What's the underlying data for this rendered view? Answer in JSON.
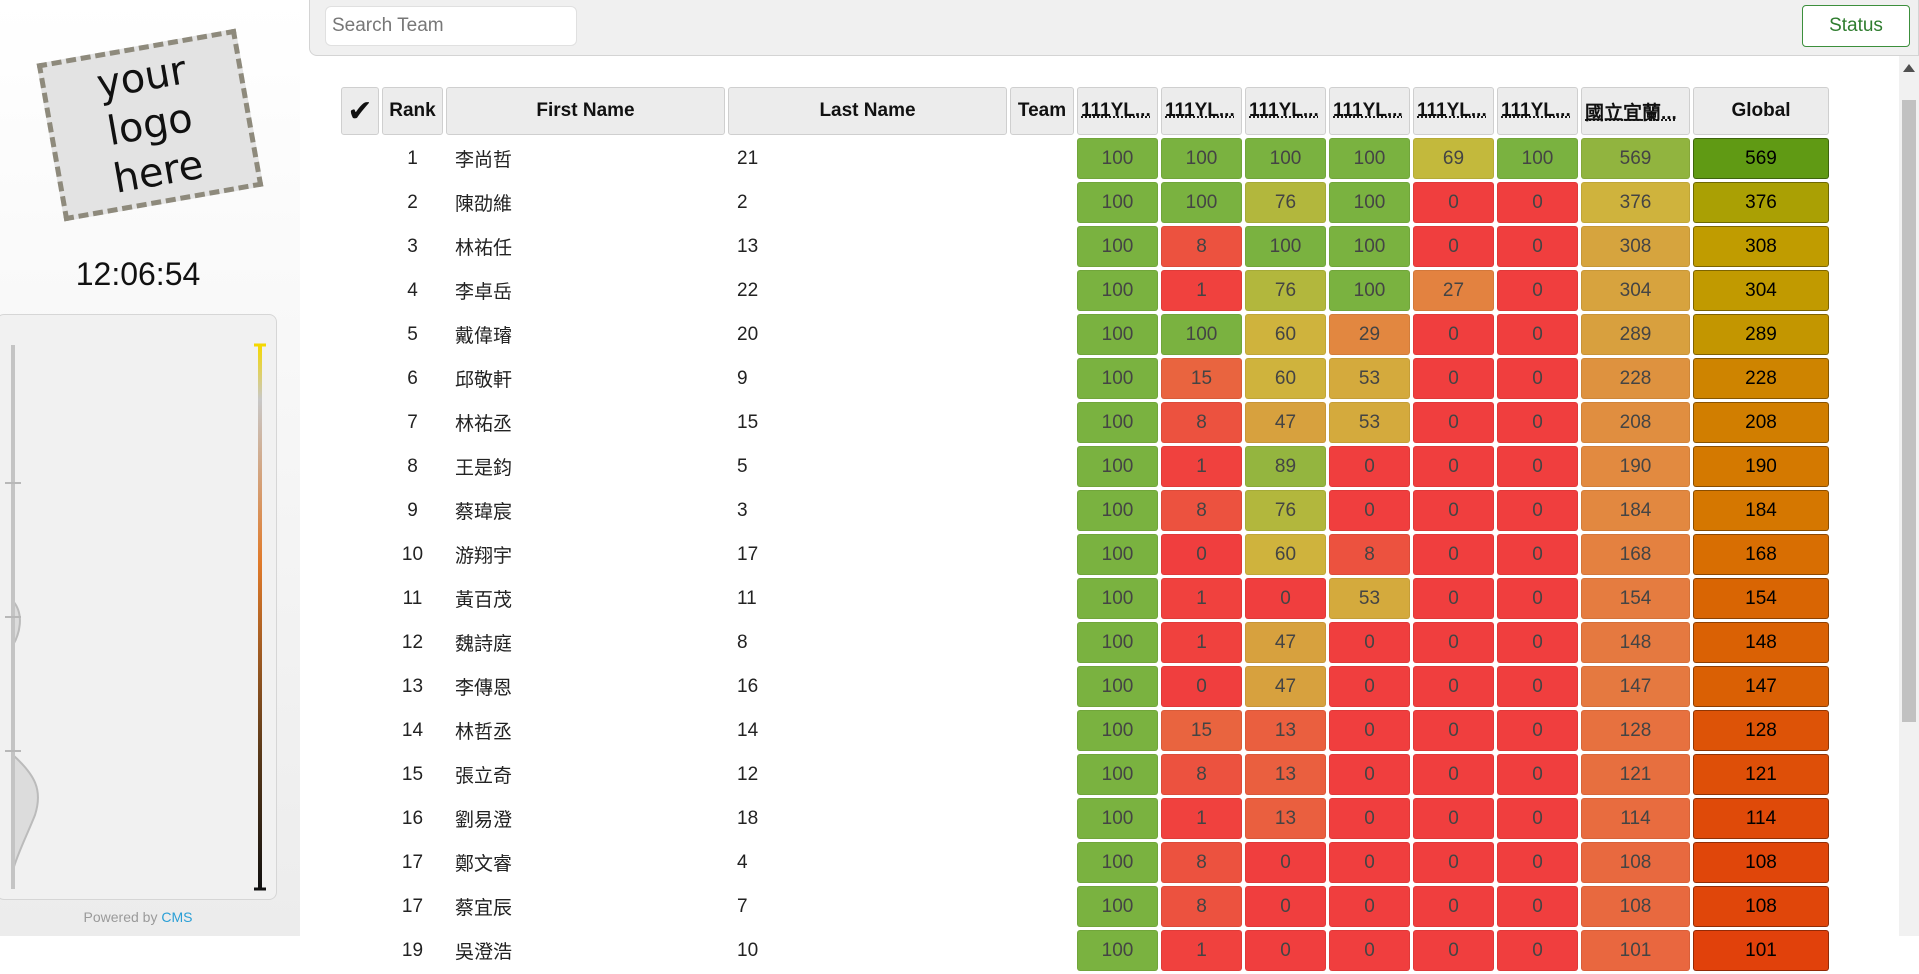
{
  "sidebar": {
    "logo_text": "your\nlogo\nhere",
    "clock": "12:06:54",
    "powered_by_prefix": "Powered by ",
    "powered_by_link": "CMS",
    "scale_colors": [
      "#f5d800",
      "#c8c8c8",
      "#e07a2a",
      "#111111"
    ]
  },
  "search": {
    "placeholder": "Search Team"
  },
  "status_label": "Status",
  "table": {
    "headers": {
      "check": "✔",
      "rank": "Rank",
      "first_name": "First Name",
      "last_name": "Last Name",
      "team": "Team",
      "tasks": [
        "111YL...",
        "111YL...",
        "111YL...",
        "111YL...",
        "111YL...",
        "111YL..."
      ],
      "contest": "國立宜蘭...",
      "global": "Global"
    },
    "max_scores": {
      "task": 100,
      "contest": 600,
      "global": 600
    },
    "rows": [
      {
        "rank": "1",
        "first": "李尚哲",
        "last": "21",
        "team": "",
        "tasks": [
          "100",
          "100",
          "100",
          "100",
          "69",
          "100"
        ],
        "contest": "569",
        "global": "569"
      },
      {
        "rank": "2",
        "first": "陳劭維",
        "last": "2",
        "team": "",
        "tasks": [
          "100",
          "100",
          "76",
          "100",
          "0",
          "0"
        ],
        "contest": "376",
        "global": "376"
      },
      {
        "rank": "3",
        "first": "林祐任",
        "last": "13",
        "team": "",
        "tasks": [
          "100",
          "8",
          "100",
          "100",
          "0",
          "0"
        ],
        "contest": "308",
        "global": "308"
      },
      {
        "rank": "4",
        "first": "李卓岳",
        "last": "22",
        "team": "",
        "tasks": [
          "100",
          "1",
          "76",
          "100",
          "27",
          "0"
        ],
        "contest": "304",
        "global": "304"
      },
      {
        "rank": "5",
        "first": "戴偉璿",
        "last": "20",
        "team": "",
        "tasks": [
          "100",
          "100",
          "60",
          "29",
          "0",
          "0"
        ],
        "contest": "289",
        "global": "289"
      },
      {
        "rank": "6",
        "first": "邱敬軒",
        "last": "9",
        "team": "",
        "tasks": [
          "100",
          "15",
          "60",
          "53",
          "0",
          "0"
        ],
        "contest": "228",
        "global": "228"
      },
      {
        "rank": "7",
        "first": "林祐丞",
        "last": "15",
        "team": "",
        "tasks": [
          "100",
          "8",
          "47",
          "53",
          "0",
          "0"
        ],
        "contest": "208",
        "global": "208"
      },
      {
        "rank": "8",
        "first": "王是鈞",
        "last": "5",
        "team": "",
        "tasks": [
          "100",
          "1",
          "89",
          "0",
          "0",
          "0"
        ],
        "contest": "190",
        "global": "190"
      },
      {
        "rank": "9",
        "first": "蔡瑋宸",
        "last": "3",
        "team": "",
        "tasks": [
          "100",
          "8",
          "76",
          "0",
          "0",
          "0"
        ],
        "contest": "184",
        "global": "184"
      },
      {
        "rank": "10",
        "first": "游翔宇",
        "last": "17",
        "team": "",
        "tasks": [
          "100",
          "0",
          "60",
          "8",
          "0",
          "0"
        ],
        "contest": "168",
        "global": "168"
      },
      {
        "rank": "11",
        "first": "黃百茂",
        "last": "11",
        "team": "",
        "tasks": [
          "100",
          "1",
          "0",
          "53",
          "0",
          "0"
        ],
        "contest": "154",
        "global": "154"
      },
      {
        "rank": "12",
        "first": "魏詩庭",
        "last": "8",
        "team": "",
        "tasks": [
          "100",
          "1",
          "47",
          "0",
          "0",
          "0"
        ],
        "contest": "148",
        "global": "148"
      },
      {
        "rank": "13",
        "first": "李傳恩",
        "last": "16",
        "team": "",
        "tasks": [
          "100",
          "0",
          "47",
          "0",
          "0",
          "0"
        ],
        "contest": "147",
        "global": "147"
      },
      {
        "rank": "14",
        "first": "林哲丞",
        "last": "14",
        "team": "",
        "tasks": [
          "100",
          "15",
          "13",
          "0",
          "0",
          "0"
        ],
        "contest": "128",
        "global": "128"
      },
      {
        "rank": "15",
        "first": "張立奇",
        "last": "12",
        "team": "",
        "tasks": [
          "100",
          "8",
          "13",
          "0",
          "0",
          "0"
        ],
        "contest": "121",
        "global": "121"
      },
      {
        "rank": "16",
        "first": "劉易澄",
        "last": "18",
        "team": "",
        "tasks": [
          "100",
          "1",
          "13",
          "0",
          "0",
          "0"
        ],
        "contest": "114",
        "global": "114"
      },
      {
        "rank": "17",
        "first": "鄭文睿",
        "last": "4",
        "team": "",
        "tasks": [
          "100",
          "8",
          "0",
          "0",
          "0",
          "0"
        ],
        "contest": "108",
        "global": "108"
      },
      {
        "rank": "17",
        "first": "蔡宜辰",
        "last": "7",
        "team": "",
        "tasks": [
          "100",
          "8",
          "0",
          "0",
          "0",
          "0"
        ],
        "contest": "108",
        "global": "108"
      },
      {
        "rank": "19",
        "first": "吳澄浩",
        "last": "10",
        "team": "",
        "tasks": [
          "100",
          "1",
          "0",
          "0",
          "0",
          "0"
        ],
        "contest": "101",
        "global": "101"
      }
    ]
  }
}
